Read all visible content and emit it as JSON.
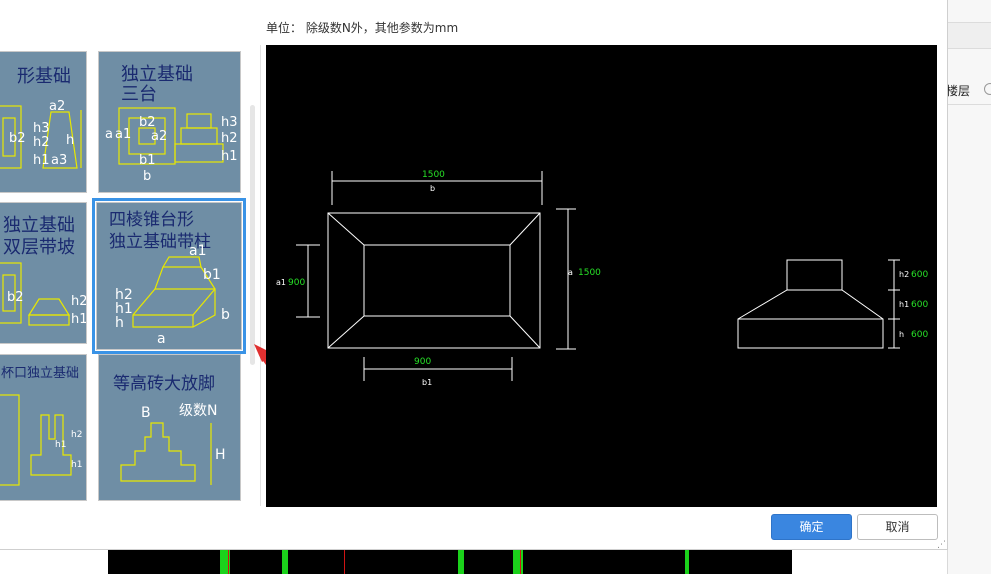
{
  "dialog": {
    "unit_note": "单位： 除级数N外，其他参数为mm",
    "ok_label": "确定",
    "cancel_label": "取消"
  },
  "background": {
    "right_panel_text": "楼层"
  },
  "gallery": {
    "items": [
      {
        "title_line1": "形基础",
        "title_line2": "",
        "labels": [
          "a2",
          "b2",
          "h3",
          "h2",
          "h1",
          "h",
          "a3"
        ]
      },
      {
        "title_line1": "独立基础",
        "title_line2": "三台",
        "labels": [
          "b2",
          "a1",
          "a",
          "a2",
          "b1",
          "b",
          "h3",
          "h2",
          "h1"
        ]
      },
      {
        "title_line1": "独立基础",
        "title_line2": "双层带坡",
        "labels": [
          "b2",
          "h2",
          "h1"
        ]
      },
      {
        "title_line1": "四棱锥台形",
        "title_line2": "独立基础带柱",
        "labels": [
          "a1",
          "b1",
          "h2",
          "h1",
          "h",
          "a",
          "b"
        ]
      },
      {
        "title_line1": "杯口独立基础",
        "title_line2": "",
        "labels": [
          "h1",
          "h2",
          "h1"
        ]
      },
      {
        "title_line1": "等高砖大放脚",
        "title_line2": "",
        "labels": [
          "B",
          "级数N",
          "H"
        ]
      }
    ],
    "selected_index": 3
  },
  "preview": {
    "plan": {
      "b_value": "1500",
      "b_label": "b",
      "a_value": "1500",
      "a_label": "a",
      "a1_value": "900",
      "a1_label": "a1",
      "b1_value": "900",
      "b1_label": "b1"
    },
    "section": {
      "h2_label": "h2",
      "h2_value": "600",
      "h1_label": "h1",
      "h1_value": "600",
      "h_label": "h",
      "h_value": "600"
    },
    "colors": {
      "dimension_value": "#27e027",
      "line": "#ffffff"
    }
  }
}
